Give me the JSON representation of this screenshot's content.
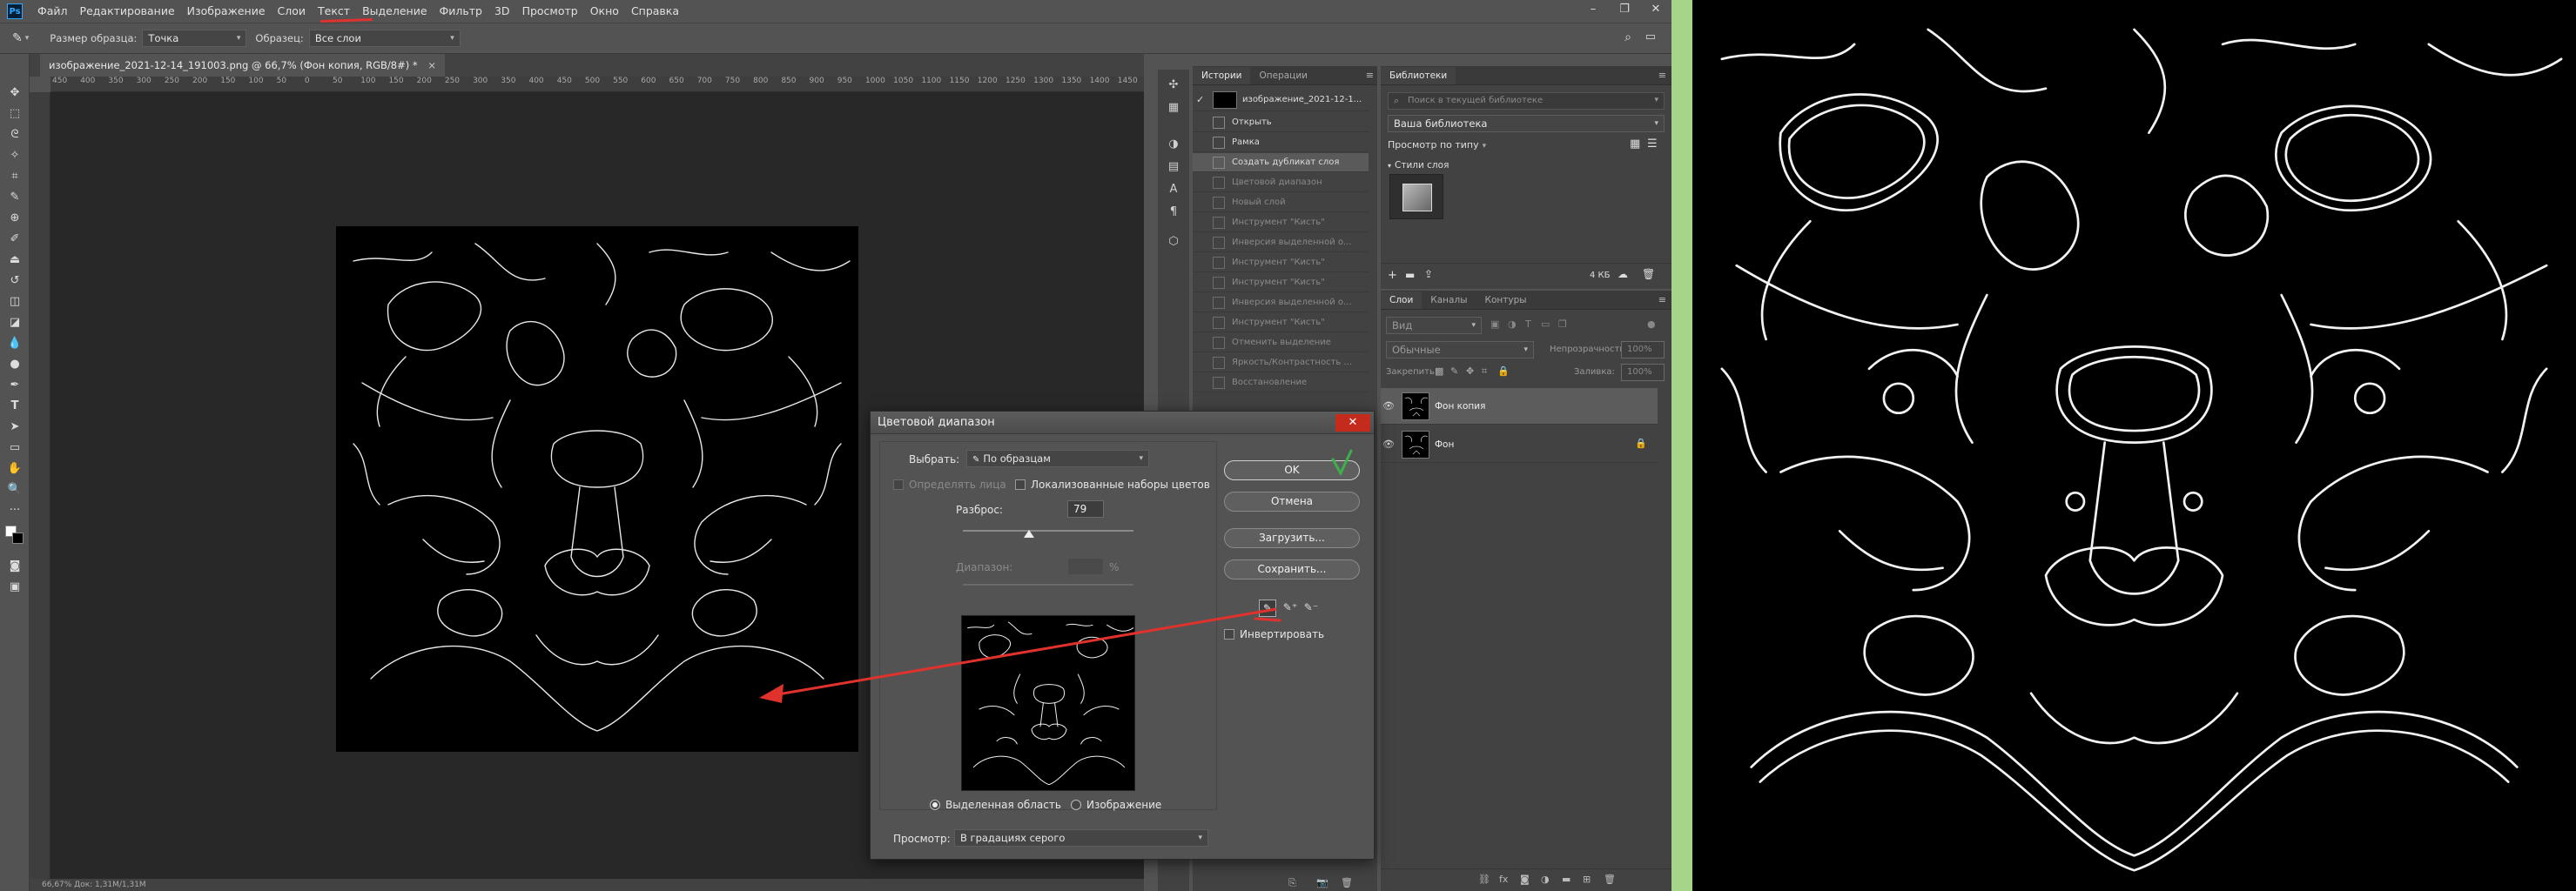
{
  "menubar": {
    "logo": "Ps",
    "items": [
      "Файл",
      "Редактирование",
      "Изображение",
      "Слои",
      "Текст",
      "Выделение",
      "Фильтр",
      "3D",
      "Просмотр",
      "Окно",
      "Справка"
    ],
    "highlighted_item": "Выделение"
  },
  "options_bar": {
    "sample_size_label": "Размер образца:",
    "sample_size_value": "Точка",
    "samples_label": "Образец:",
    "samples_value": "Все слои"
  },
  "document": {
    "tab_title": "изображение_2021-12-14_191003.png @ 66,7% (Фон копия, RGB/8#) *",
    "close_glyph": "×",
    "ruler_ticks": [
      "450",
      "400",
      "350",
      "300",
      "250",
      "200",
      "150",
      "100",
      "50",
      "0",
      "50",
      "100",
      "150",
      "200",
      "250",
      "300",
      "350",
      "400",
      "450",
      "500",
      "550",
      "600",
      "650",
      "700",
      "750",
      "800",
      "850",
      "900",
      "950",
      "1000",
      "1050",
      "1100",
      "1150",
      "1200",
      "1250",
      "1300",
      "1350",
      "1400",
      "1450"
    ],
    "status": "66,67%   Док: 1,31M/1,31M"
  },
  "history_panel": {
    "tabs": [
      "Истории",
      "Операции"
    ],
    "snapshot_label": "изображение_2021-12-1...",
    "items": [
      {
        "label": "Открыть",
        "state": "normal"
      },
      {
        "label": "Рамка",
        "state": "normal"
      },
      {
        "label": "Создать дубликат слоя",
        "state": "current"
      },
      {
        "label": "Цветовой диапазон",
        "state": "dim"
      },
      {
        "label": "Новый слой",
        "state": "dim"
      },
      {
        "label": "Инструмент \"Кисть\"",
        "state": "dim"
      },
      {
        "label": "Инверсия выделенной о...",
        "state": "dim"
      },
      {
        "label": "Инструмент \"Кисть\"",
        "state": "dim"
      },
      {
        "label": "Инструмент \"Кисть\"",
        "state": "dim"
      },
      {
        "label": "Инверсия выделенной о...",
        "state": "dim"
      },
      {
        "label": "Инструмент \"Кисть\"",
        "state": "dim"
      },
      {
        "label": "Отменить выделение",
        "state": "dim"
      },
      {
        "label": "Яркость/Контрастность ...",
        "state": "dim"
      },
      {
        "label": "Восстановление",
        "state": "dim"
      }
    ]
  },
  "libraries_panel": {
    "tab": "Библиотеки",
    "search_placeholder": "Поиск в текущей библиотеке",
    "library_select": "Ваша библиотека",
    "view_by": "Просмотр по типу",
    "section": "Стили слоя",
    "size": "4 КБ"
  },
  "layers_panel": {
    "tabs": [
      "Слои",
      "Каналы",
      "Контуры"
    ],
    "kind_placeholder": "Вид",
    "blend_mode": "Обычные",
    "opacity_label": "Непрозрачность:",
    "opacity_value": "100%",
    "lock_label": "Закрепить:",
    "fill_label": "Заливка:",
    "fill_value": "100%",
    "layers": [
      {
        "name": "Фон копия",
        "selected": true,
        "locked": false
      },
      {
        "name": "Фон",
        "selected": false,
        "locked": true
      }
    ]
  },
  "dialog": {
    "title": "Цветовой диапазон",
    "close_glyph": "✕",
    "select_label": "Выбрать:",
    "select_value": "По образцам",
    "detect_faces_label": "Определять лица",
    "localized_label": "Локализованные наборы цветов",
    "fuzziness_label": "Разброс:",
    "fuzziness_value": "79",
    "fuzziness_slider_fraction": 0.39,
    "range_label": "Диапазон:",
    "range_unit": "%",
    "selection_radio": "Выделенная область",
    "image_radio": "Изображение",
    "preview_label": "Просмотр:",
    "preview_value": "В градациях серого",
    "buttons": {
      "ok": "OK",
      "cancel": "Отмена",
      "load": "Загрузить...",
      "save": "Сохранить..."
    },
    "invert_label": "Инвертировать"
  }
}
